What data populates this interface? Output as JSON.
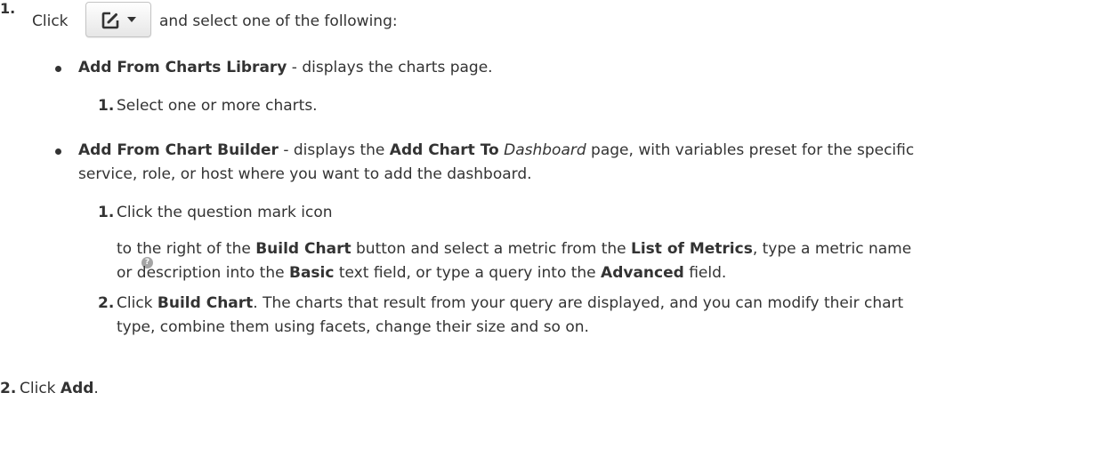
{
  "steps": [
    {
      "number": "1.",
      "intro": {
        "pre": "Click",
        "post": "and select one of the following:"
      },
      "options": [
        {
          "title": "Add From Charts Library",
          "description": " - displays the charts page.",
          "substeps": [
            {
              "number": "1.",
              "text": "Select one or more charts."
            }
          ]
        },
        {
          "title": "Add From Chart Builder",
          "description_pre": " - displays the ",
          "bold": "Add Chart To",
          "italic": "Dashboard",
          "description_post": " page, with variables preset for the specific",
          "description_line2": "service, role, or host where you want to add the dashboard.",
          "substeps": [
            {
              "number": "1.",
              "line1": "Click the question mark icon",
              "line2": {
                "t1": "to the right of the ",
                "b1": "Build Chart",
                "t2": " button and select a metric from the ",
                "b2": "List of Metrics",
                "t3": ", type a metric name"
              },
              "line3": {
                "t1": "or description into the ",
                "b1": "Basic",
                "t2": " text field, or type a query into the ",
                "b2": "Advanced",
                "t3": " field."
              }
            },
            {
              "number": "2.",
              "line1": {
                "t1": "Click ",
                "b1": "Build Chart",
                "t2": ". The charts that result from your query are displayed, and you can modify their chart"
              },
              "line2": "type, combine them using facets, change their size and so on."
            }
          ]
        }
      ]
    },
    {
      "number": "2.",
      "text": {
        "t1": "Click ",
        "b1": "Add",
        "t2": "."
      }
    }
  ]
}
